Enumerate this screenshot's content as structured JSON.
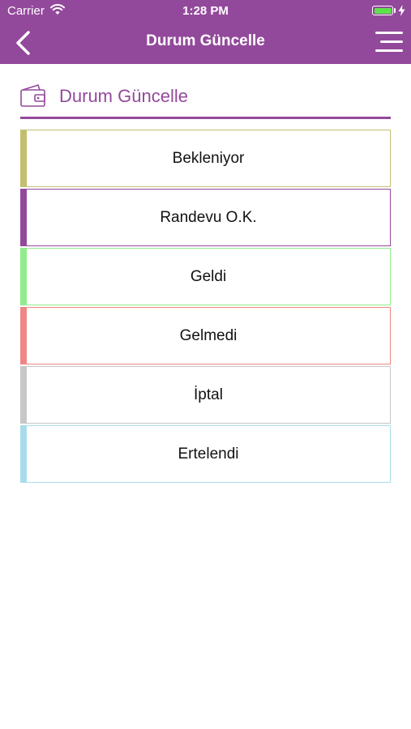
{
  "status_bar": {
    "carrier": "Carrier",
    "time": "1:28 PM"
  },
  "nav": {
    "title": "Durum Güncelle"
  },
  "section": {
    "title": "Durum Güncelle"
  },
  "statuses": [
    {
      "label": "Bekleniyor",
      "color": "#c2bf6e"
    },
    {
      "label": "Randevu O.K.",
      "color": "#93499b"
    },
    {
      "label": "Geldi",
      "color": "#8fed8b"
    },
    {
      "label": "Gelmedi",
      "color": "#f08684"
    },
    {
      "label": "İptal",
      "color": "#c7c7c7"
    },
    {
      "label": "Ertelendi",
      "color": "#a7dcea"
    }
  ],
  "colors": {
    "accent": "#93499b",
    "battery": "#5fe14b"
  },
  "icons": [
    "wifi-icon",
    "battery-icon",
    "charging-bolt-icon",
    "back-chevron-icon",
    "hamburger-menu-icon",
    "wallet-icon"
  ]
}
